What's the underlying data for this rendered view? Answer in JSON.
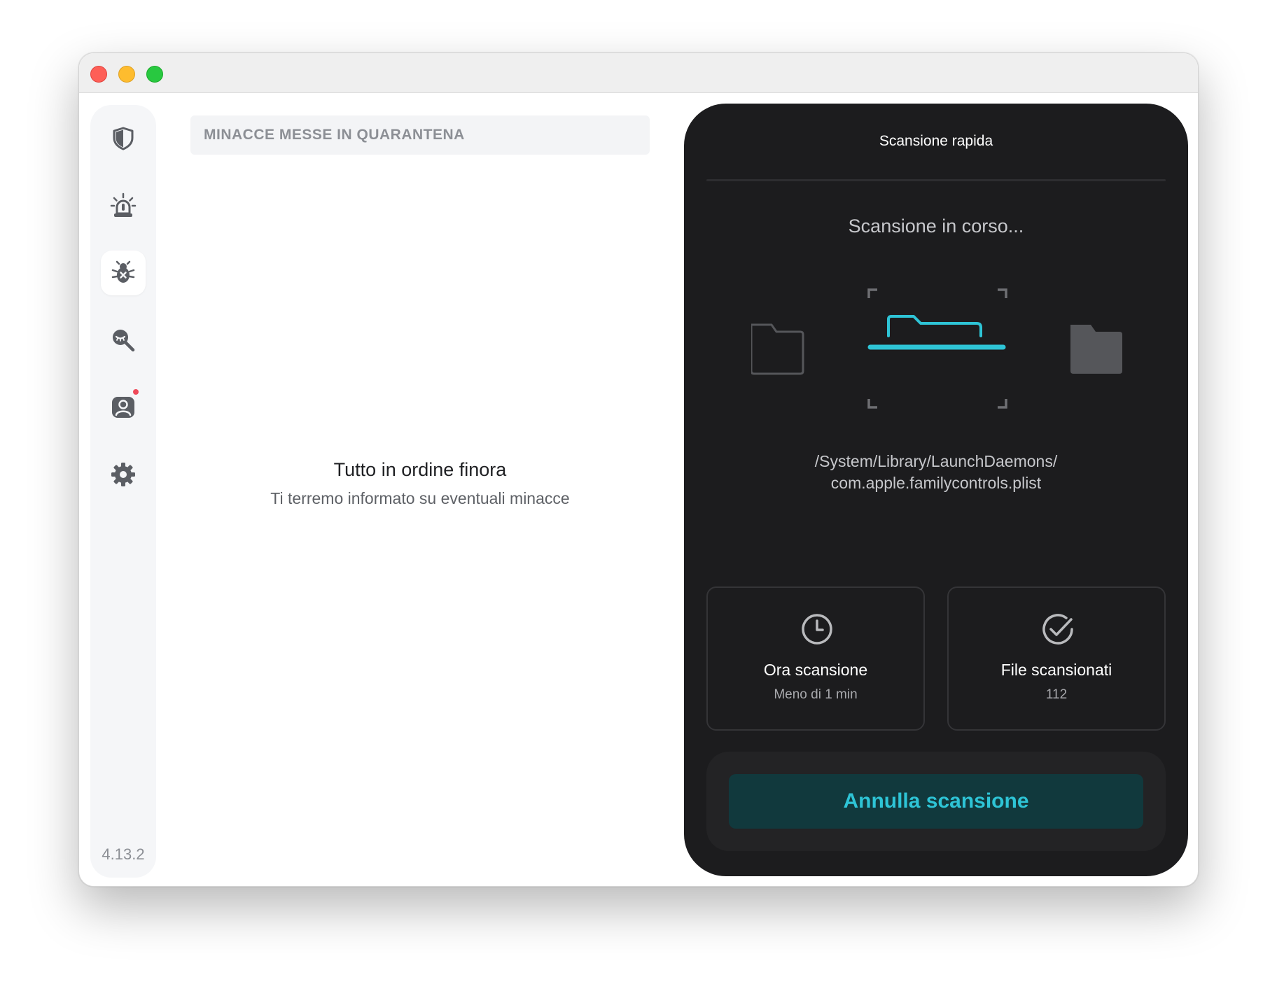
{
  "window": {
    "controls": [
      "close",
      "minimize",
      "maximize"
    ]
  },
  "sidebar": {
    "items": [
      {
        "id": "protection",
        "icon": "shield-icon",
        "active": false,
        "badge": false
      },
      {
        "id": "alerts",
        "icon": "alarm-icon",
        "active": false,
        "badge": false
      },
      {
        "id": "threats",
        "icon": "bug-icon",
        "active": true,
        "badge": false
      },
      {
        "id": "scanner",
        "icon": "magnifier-icon",
        "active": false,
        "badge": false
      },
      {
        "id": "account",
        "icon": "user-icon",
        "active": false,
        "badge": true
      },
      {
        "id": "settings",
        "icon": "gear-icon",
        "active": false,
        "badge": false
      }
    ],
    "version": "4.13.2"
  },
  "quarantine": {
    "header": "MINACCE MESSE IN QUARANTENA",
    "empty_title": "Tutto in ordine finora",
    "empty_subtitle": "Ti terremo informato su eventuali minacce"
  },
  "scan": {
    "title": "Scansione rapida",
    "status": "Scansione in corso...",
    "path_line1": "/System/Library/LaunchDaemons/",
    "path_line2": "com.apple.familycontrols.plist",
    "stats": [
      {
        "icon": "clock-icon",
        "label": "Ora scansione",
        "value": "Meno di 1 min"
      },
      {
        "icon": "checkmark-icon",
        "label": "File scansionati",
        "value": "112"
      }
    ],
    "cancel_label": "Annulla scansione"
  },
  "colors": {
    "accent": "#2ec4d6",
    "panel_bg": "#1c1c1e",
    "button_bg": "#11393d",
    "badge": "#ef4a5a"
  }
}
